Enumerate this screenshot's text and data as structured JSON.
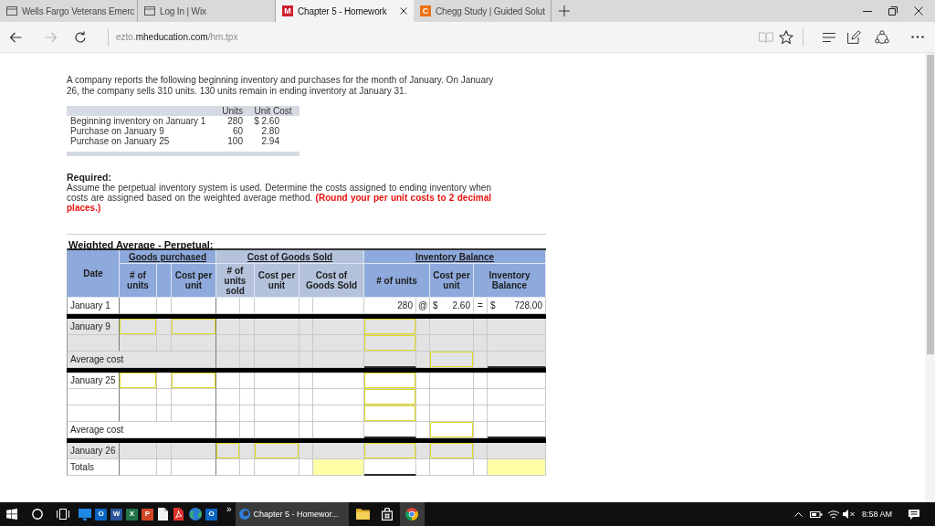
{
  "browser": {
    "tabs": [
      {
        "title": "Wells Fargo Veterans Emerc",
        "selected": false,
        "kind": "page"
      },
      {
        "title": "Log In | Wix",
        "selected": false,
        "kind": "page"
      },
      {
        "title": "Chapter 5 - Homework",
        "selected": true,
        "kind": "letter",
        "letter": "M",
        "color": "#d0202e"
      },
      {
        "title": "Chegg Study | Guided Solut",
        "selected": false,
        "kind": "letter",
        "letter": "C",
        "color": "#ec7211"
      }
    ],
    "toolbar": {
      "back_disabled": false,
      "forward_disabled": true,
      "reading_view_disabled": true,
      "address": {
        "subdomain": "ezto.",
        "domain": "mheducation.com",
        "path": "/hm.tpx"
      }
    }
  },
  "problem": {
    "text": "A company reports the following beginning inventory and purchases for the month of January. On January 26, the company sells 310 units. 130 units remain in ending inventory at January 31.",
    "data_table": {
      "columns": [
        "Units",
        "Unit Cost"
      ],
      "rows": [
        {
          "label": "Beginning inventory on January 1",
          "units": "280",
          "unit_cost": "$ 2.60"
        },
        {
          "label": "Purchase on January 9",
          "units": "60",
          "unit_cost": "2.80"
        },
        {
          "label": "Purchase on January 25",
          "units": "100",
          "unit_cost": "2.94"
        }
      ]
    }
  },
  "required": {
    "heading": "Required:",
    "text": "Assume the perpetual inventory system is used. Determine the costs assigned to ending inventory when costs are assigned based on the weighted average method.",
    "note": "(Round your per unit costs to 2 decimal places.)"
  },
  "worksheet": {
    "title": "Weighted Average - Perpetual:",
    "date_header": "Date",
    "groups": [
      {
        "label": "Goods purchased",
        "color": "#8ea9db",
        "columns": [
          "# of units",
          "Cost per unit"
        ]
      },
      {
        "label": "Cost of Goods Sold",
        "color": "#b4c2dc",
        "columns": [
          "# of units sold",
          "Cost per unit",
          "Cost of Goods Sold"
        ]
      },
      {
        "label": "Inventory Balance",
        "color": "#8ea9db",
        "columns": [
          "# of units",
          "Cost per unit",
          "Inventory Balance"
        ]
      }
    ],
    "sections": [
      {
        "rows": [
          {
            "kind": "entry",
            "label": "January 1",
            "shaded": false,
            "cells": [
              {
                "kind": "blank"
              },
              {
                "kind": "blank"
              },
              {
                "kind": "blank"
              },
              {
                "kind": "blank"
              },
              {
                "kind": "blank"
              },
              {
                "kind": "blank"
              },
              {
                "kind": "blank"
              },
              {
                "kind": "blank"
              },
              {
                "kind": "text",
                "text": "280"
              },
              {
                "kind": "text",
                "text": "@"
              },
              {
                "kind": "amount",
                "symbol": "$",
                "text": "2.60"
              },
              {
                "kind": "text",
                "text": "="
              },
              {
                "kind": "amount",
                "symbol": "$",
                "text": "728.00"
              }
            ]
          }
        ]
      },
      {
        "rows": [
          {
            "kind": "entry",
            "label": "January 9",
            "shaded": true,
            "cells": [
              {
                "kind": "input"
              },
              {
                "kind": "blank"
              },
              {
                "kind": "input"
              },
              {
                "kind": "blank"
              },
              {
                "kind": "blank"
              },
              {
                "kind": "blank"
              },
              {
                "kind": "blank"
              },
              {
                "kind": "blank"
              },
              {
                "kind": "input"
              },
              {
                "kind": "blank"
              },
              {
                "kind": "blank"
              },
              {
                "kind": "blank"
              },
              {
                "kind": "blank"
              }
            ]
          },
          {
            "kind": "entry",
            "shaded": true,
            "cells": [
              {
                "kind": "blank"
              },
              {
                "kind": "blank"
              },
              {
                "kind": "blank"
              },
              {
                "kind": "blank"
              },
              {
                "kind": "blank"
              },
              {
                "kind": "blank"
              },
              {
                "kind": "blank"
              },
              {
                "kind": "blank"
              },
              {
                "kind": "input"
              },
              {
                "kind": "blank"
              },
              {
                "kind": "blank"
              },
              {
                "kind": "blank"
              },
              {
                "kind": "blank"
              }
            ]
          },
          {
            "kind": "subtotal",
            "label": "Average cost",
            "shaded": true,
            "cells": [
              {
                "kind": "blank"
              },
              {
                "kind": "blank"
              },
              {
                "kind": "blank"
              },
              {
                "kind": "blank"
              },
              {
                "kind": "blank"
              },
              {
                "kind": "ruled"
              },
              {
                "kind": "blank"
              },
              {
                "kind": "input"
              },
              {
                "kind": "blank"
              },
              {
                "kind": "ruled"
              }
            ]
          }
        ]
      },
      {
        "rows": [
          {
            "kind": "entry",
            "label": "January 25",
            "shaded": false,
            "cells": [
              {
                "kind": "input"
              },
              {
                "kind": "blank"
              },
              {
                "kind": "input"
              },
              {
                "kind": "blank"
              },
              {
                "kind": "blank"
              },
              {
                "kind": "blank"
              },
              {
                "kind": "blank"
              },
              {
                "kind": "blank"
              },
              {
                "kind": "input"
              },
              {
                "kind": "blank"
              },
              {
                "kind": "blank"
              },
              {
                "kind": "blank"
              },
              {
                "kind": "blank"
              }
            ]
          },
          {
            "kind": "entry",
            "shaded": false,
            "cells": [
              {
                "kind": "blank"
              },
              {
                "kind": "blank"
              },
              {
                "kind": "blank"
              },
              {
                "kind": "blank"
              },
              {
                "kind": "blank"
              },
              {
                "kind": "blank"
              },
              {
                "kind": "blank"
              },
              {
                "kind": "blank"
              },
              {
                "kind": "input"
              },
              {
                "kind": "blank"
              },
              {
                "kind": "blank"
              },
              {
                "kind": "blank"
              },
              {
                "kind": "blank"
              }
            ]
          },
          {
            "kind": "entry",
            "shaded": false,
            "cells": [
              {
                "kind": "blank"
              },
              {
                "kind": "blank"
              },
              {
                "kind": "blank"
              },
              {
                "kind": "blank"
              },
              {
                "kind": "blank"
              },
              {
                "kind": "blank"
              },
              {
                "kind": "blank"
              },
              {
                "kind": "blank"
              },
              {
                "kind": "input"
              },
              {
                "kind": "blank"
              },
              {
                "kind": "blank"
              },
              {
                "kind": "blank"
              },
              {
                "kind": "blank"
              }
            ]
          },
          {
            "kind": "subtotal",
            "label": "Average cost",
            "shaded": false,
            "cells": [
              {
                "kind": "blank"
              },
              {
                "kind": "blank"
              },
              {
                "kind": "blank"
              },
              {
                "kind": "blank"
              },
              {
                "kind": "blank"
              },
              {
                "kind": "ruled"
              },
              {
                "kind": "blank"
              },
              {
                "kind": "input"
              },
              {
                "kind": "blank"
              },
              {
                "kind": "ruled"
              }
            ]
          }
        ]
      },
      {
        "rows": [
          {
            "kind": "entry",
            "label": "January 26",
            "shaded": true,
            "cells": [
              {
                "kind": "blank"
              },
              {
                "kind": "blank"
              },
              {
                "kind": "blank"
              },
              {
                "kind": "input"
              },
              {
                "kind": "blank"
              },
              {
                "kind": "input"
              },
              {
                "kind": "blank"
              },
              {
                "kind": "blank"
              },
              {
                "kind": "input"
              },
              {
                "kind": "blank"
              },
              {
                "kind": "input"
              },
              {
                "kind": "blank"
              },
              {
                "kind": "blank"
              }
            ]
          },
          {
            "kind": "entry",
            "label": "Totals",
            "shaded": false,
            "cells": [
              {
                "kind": "blank"
              },
              {
                "kind": "blank"
              },
              {
                "kind": "blank"
              },
              {
                "kind": "blank"
              },
              {
                "kind": "blank"
              },
              {
                "kind": "blank"
              },
              {
                "kind": "blank"
              },
              {
                "kind": "total"
              },
              {
                "kind": "ruled"
              },
              {
                "kind": "blank"
              },
              {
                "kind": "blank"
              },
              {
                "kind": "blank"
              },
              {
                "kind": "total"
              }
            ]
          }
        ]
      }
    ]
  },
  "taskbar": {
    "apps": [
      {
        "kind": "monitor"
      },
      {
        "kind": "tile",
        "letter": "O",
        "color": "#0a64c2"
      },
      {
        "kind": "tile",
        "letter": "W",
        "color": "#2b579a"
      },
      {
        "kind": "tile",
        "letter": "X",
        "color": "#217346"
      },
      {
        "kind": "tile",
        "letter": "P",
        "color": "#d24726"
      },
      {
        "kind": "document"
      },
      {
        "kind": "pdf"
      },
      {
        "kind": "globe"
      },
      {
        "kind": "tile",
        "letter": "O",
        "color": "#0a64c2"
      }
    ],
    "overflow": "»",
    "task": "Chapter 5 - Homewor...",
    "pinned": [
      {
        "kind": "folder",
        "selected": false
      },
      {
        "kind": "store",
        "selected": false
      },
      {
        "kind": "chrome",
        "selected": true
      }
    ],
    "clock": "8:58 AM"
  }
}
